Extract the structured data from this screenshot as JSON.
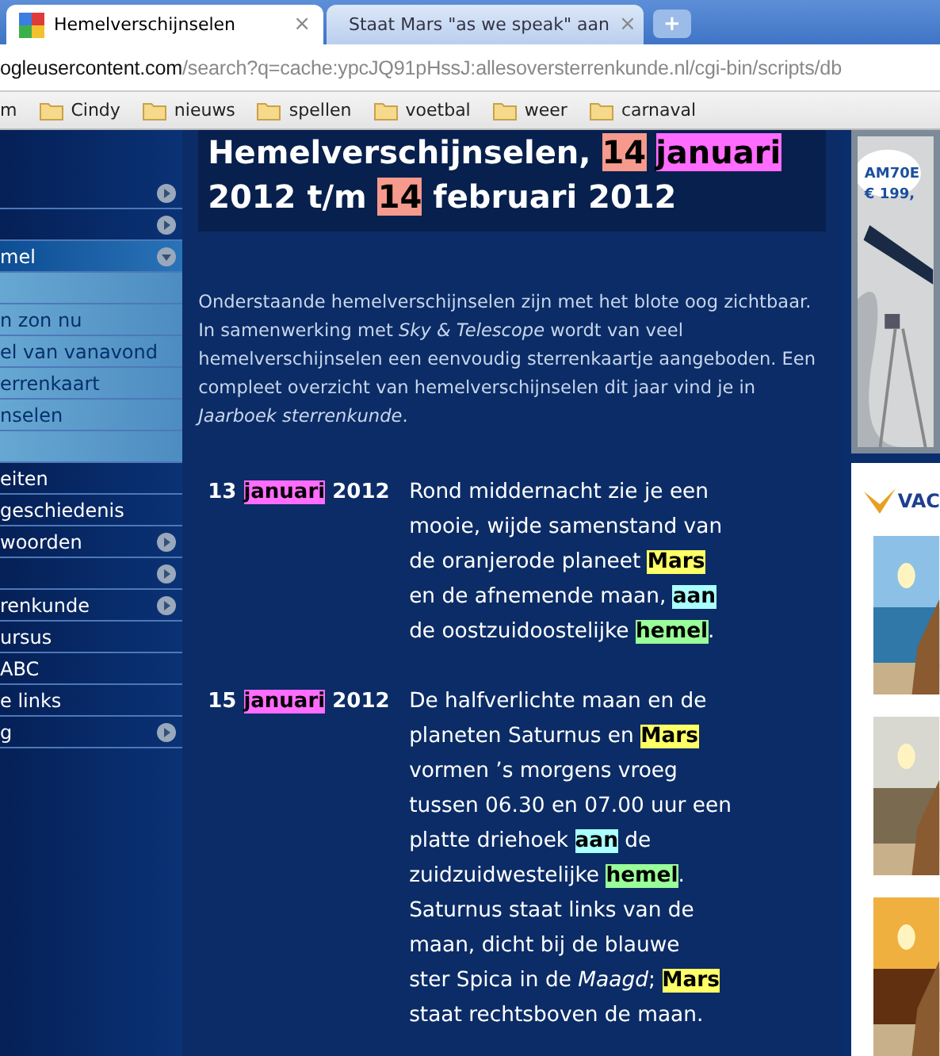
{
  "tabs": [
    {
      "title": "Hemelverschijnselen",
      "selected": true,
      "close": "×"
    },
    {
      "title": "Staat Mars \"as we speak\" aan",
      "selected": false,
      "close": "×"
    }
  ],
  "new_tab": "+",
  "address": {
    "host": "ogleusercontent.com",
    "path": "/search?q=cache:ypcJQ91pHssJ:allesoversterrenkunde.nl/cgi-bin/scripts/db"
  },
  "bookmarks": [
    {
      "label": "m",
      "kind": "text"
    },
    {
      "label": "Cindy",
      "kind": "folder"
    },
    {
      "label": "nieuws",
      "kind": "folder"
    },
    {
      "label": "spellen",
      "kind": "folder"
    },
    {
      "label": "voetbal",
      "kind": "folder"
    },
    {
      "label": "weer",
      "kind": "folder"
    },
    {
      "label": "carnaval",
      "kind": "folder"
    }
  ],
  "sidebar": [
    {
      "kind": "main",
      "expanded": false,
      "selected": false
    },
    {
      "kind": "main",
      "expanded": false,
      "selected": false
    },
    {
      "kind": "main",
      "label": "mel",
      "expanded": true,
      "selected": true
    },
    {
      "kind": "sub",
      "selected": false
    },
    {
      "kind": "sub",
      "label": "n zon nu",
      "selected": false
    },
    {
      "kind": "sub",
      "label": "el van vanavond",
      "selected": false
    },
    {
      "kind": "sub",
      "label": "errenkaart",
      "selected": false
    },
    {
      "kind": "sub",
      "label": "nselen",
      "selected": false
    },
    {
      "kind": "sub",
      "selected": false
    },
    {
      "kind": "main",
      "label": "eiten",
      "selected": false
    },
    {
      "kind": "main",
      "label": "geschiedenis",
      "selected": false
    },
    {
      "kind": "main",
      "label": "woorden",
      "expanded": false,
      "selected": false
    },
    {
      "kind": "main",
      "expanded": false,
      "selected": false
    },
    {
      "kind": "main",
      "label": "renkunde",
      "expanded": false,
      "selected": false
    },
    {
      "kind": "main",
      "label": "ursus",
      "selected": false
    },
    {
      "kind": "main",
      "label": "ABC",
      "selected": false
    },
    {
      "kind": "main",
      "label": "e links",
      "selected": false
    },
    {
      "kind": "main",
      "label": "g",
      "expanded": false,
      "selected": false
    }
  ],
  "heading": [
    [
      {
        "text": "Hemelverschijnselen, "
      },
      {
        "text": "14",
        "color": "#f59a8c"
      },
      {
        "text": "januari",
        "color": "#ff6cff"
      }
    ],
    [
      {
        "text": "2012 t/m "
      },
      {
        "text": "14",
        "color": "#f59a8c"
      },
      {
        "text": " februari 2012"
      }
    ]
  ],
  "intro": "Onderstaande hemelverschijnselen zijn met het blote oog zichtbaar. In samenwerking met *Sky & Telescope* wordt van veel hemelverschijnselen een eenvoudig sterrenkaartje aangeboden. Een compleet overzicht van hemelverschijnselen dit jaar vind je in *Jaarboek sterrenkunde*.",
  "entries": [
    {
      "date": [
        {
          "text": "13 "
        },
        {
          "text": "januari",
          "color": "#ff6cff"
        },
        {
          "text": " 2012"
        }
      ],
      "lines": [
        [
          {
            "text": "Rond middernacht zie je een"
          }
        ],
        [
          {
            "text": "mooie, wijde samenstand van"
          }
        ],
        [
          {
            "text": "de oranjerode planeet "
          },
          {
            "text": "Mars",
            "color": "#ffff66"
          }
        ],
        [
          {
            "text": "en de afnemende maan, "
          },
          {
            "text": "aan",
            "color": "#aaffff"
          }
        ],
        [
          {
            "text": "de oostzuidoostelijke "
          },
          {
            "text": "hemel",
            "color": "#99ff99"
          },
          {
            "text": "."
          }
        ]
      ]
    },
    {
      "date": [
        {
          "text": "15 "
        },
        {
          "text": "januari",
          "color": "#ff6cff"
        },
        {
          "text": " 2012"
        }
      ],
      "lines": [
        [
          {
            "text": "De halfverlichte maan en de"
          }
        ],
        [
          {
            "text": "planeten Saturnus en "
          },
          {
            "text": "Mars",
            "color": "#ffff66"
          }
        ],
        [
          {
            "text": "vormen ’s morgens vroeg"
          }
        ],
        [
          {
            "text": "tussen 06.30 en 07.00 uur een"
          }
        ],
        [
          {
            "text": "platte driehoek "
          },
          {
            "text": "aan",
            "color": "#aaffff"
          },
          {
            "text": " de"
          }
        ],
        [
          {
            "text": "zuidzuidwestelijke "
          },
          {
            "text": "hemel",
            "color": "#99ff99"
          },
          {
            "text": "."
          }
        ],
        [
          {
            "text": "Saturnus staat links van de"
          }
        ],
        [
          {
            "text": "maan, dicht bij de blauwe"
          }
        ],
        [
          {
            "text": "ster Spica in de *Maagd*; "
          },
          {
            "text": "Mars",
            "color": "#ffff66"
          }
        ],
        [
          {
            "text": "staat rechtsboven de maan."
          }
        ]
      ]
    }
  ],
  "ads": {
    "telescope": {
      "model": "AM70E",
      "price": "€ 199,"
    },
    "logo": "VAC"
  }
}
